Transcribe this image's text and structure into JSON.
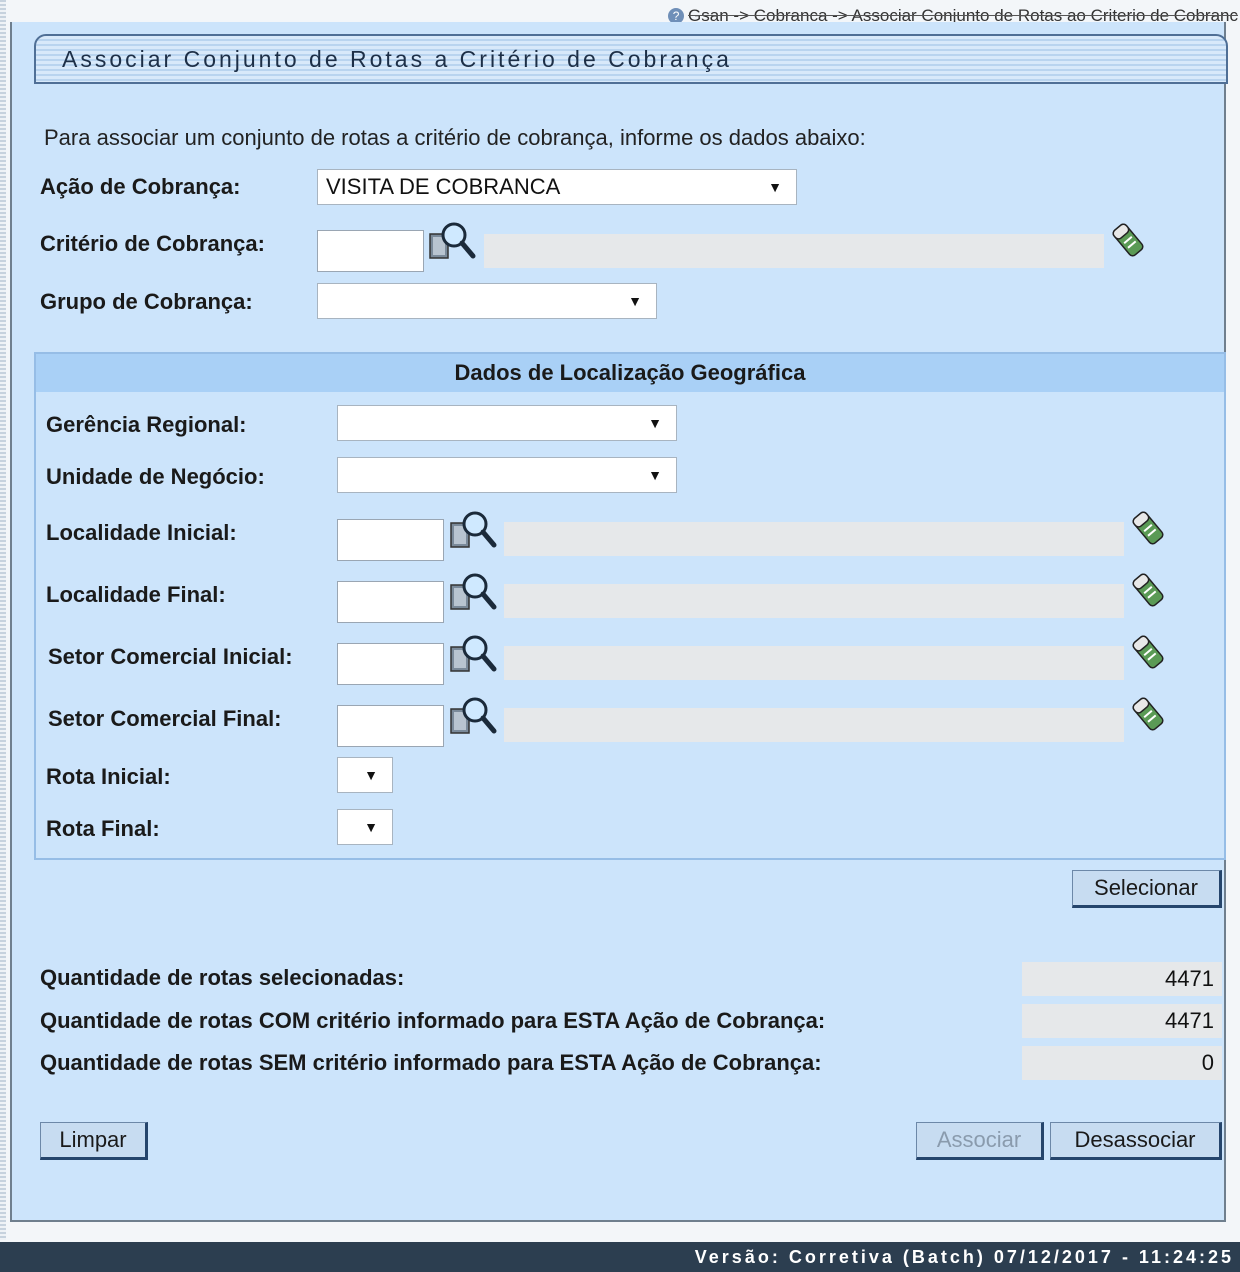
{
  "breadcrumb": "Gsan -> Cobranca -> Associar Conjunto de Rotas ao Criterio de Cobranc",
  "title": "Associar Conjunto de Rotas a Critério de Cobrança",
  "intro": "Para associar um conjunto de rotas a critério de cobrança, informe os dados abaixo:",
  "form": {
    "acao_label": "Ação de Cobrança:",
    "acao_value": "VISITA DE COBRANCA",
    "criterio_label": "Critério de Cobrança:",
    "grupo_label": "Grupo de Cobrança:"
  },
  "geo": {
    "header": "Dados de Localização Geográfica",
    "gerencia_label": "Gerência Regional:",
    "unidade_label": "Unidade de Negócio:",
    "localidade_inicial_label": "Localidade Inicial:",
    "localidade_final_label": "Localidade Final:",
    "setor_inicial_label": "Setor Comercial Inicial:",
    "setor_final_label": "Setor Comercial Final:",
    "rota_inicial_label": "Rota Inicial:",
    "rota_final_label": "Rota Final:"
  },
  "buttons": {
    "selecionar": "Selecionar",
    "limpar": "Limpar",
    "associar": "Associar",
    "desassociar": "Desassociar"
  },
  "counts": {
    "selecionadas_label": "Quantidade de rotas selecionadas:",
    "selecionadas_value": "4471",
    "com_label": "Quantidade de rotas COM critério informado para ESTA Ação de Cobrança:",
    "com_value": "4471",
    "sem_label": "Quantidade de rotas SEM critério informado para ESTA Ação de Cobrança:",
    "sem_value": "0"
  },
  "footer": "Versão: Corretiva (Batch) 07/12/2017 - 11:24:25",
  "icons": {
    "help": "help-icon",
    "lookup": "magnifier-search-icon",
    "eraser": "eraser-clear-icon",
    "dropdown": "triangle-down-icon"
  }
}
